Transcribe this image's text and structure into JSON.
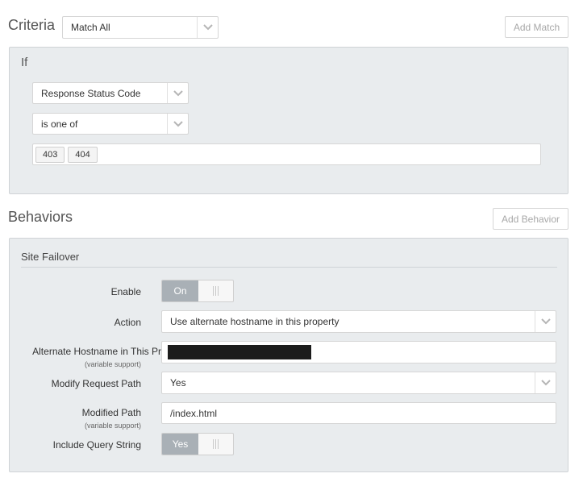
{
  "criteria": {
    "title": "Criteria",
    "match_select": "Match All",
    "add_match_label": "Add Match"
  },
  "if_block": {
    "title": "If",
    "condition_select": "Response Status Code",
    "operator_select": "is one of",
    "values": [
      "403",
      "404"
    ]
  },
  "behaviors": {
    "title": "Behaviors",
    "add_behavior_label": "Add Behavior"
  },
  "site_failover": {
    "title": "Site Failover",
    "enable_label": "Enable",
    "enable_value": "On",
    "action_label": "Action",
    "action_value": "Use alternate hostname in this property",
    "alt_hostname_label": "Alternate Hostname in This Pr",
    "alt_hostname_sub": "(variable support)",
    "modify_path_label": "Modify Request Path",
    "modify_path_value": "Yes",
    "modified_path_label": "Modified Path",
    "modified_path_sub": "(variable support)",
    "modified_path_value": "/index.html",
    "include_query_label": "Include Query String",
    "include_query_value": "Yes"
  }
}
